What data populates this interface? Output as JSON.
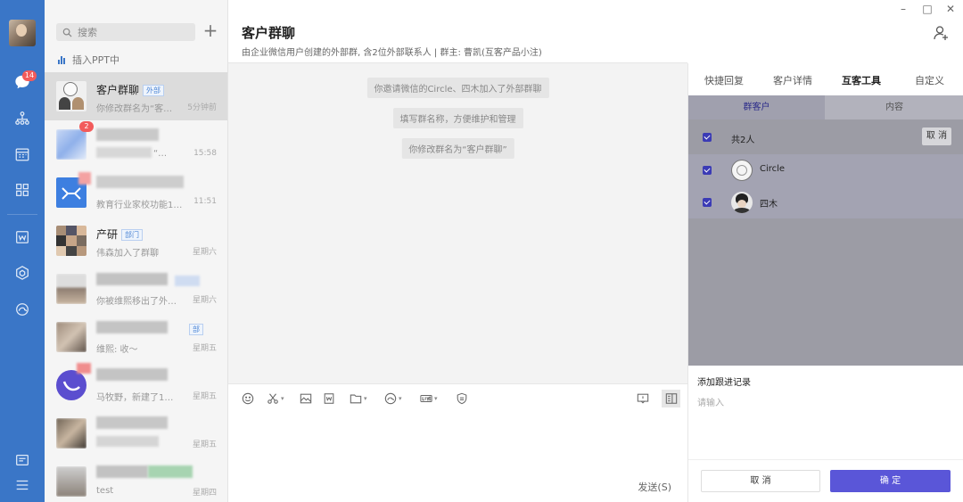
{
  "nav": {
    "badge_count": "14"
  },
  "sidebar": {
    "search_placeholder": "搜索",
    "add_symbol": "+",
    "ppt_status": "插入PPT中"
  },
  "conversations": [
    {
      "name": "客户群聊",
      "tag": "外部",
      "message": "你修改群名为“客…",
      "time": "5分钟前"
    },
    {
      "name": "",
      "tag": "",
      "message": "“…",
      "time": "15:58",
      "badge": "2"
    },
    {
      "name": "",
      "tag": "",
      "message": "教育行业家校功能1…",
      "time": "11:51"
    },
    {
      "name": "产研",
      "tag": "部门",
      "message": "伟森加入了群聊",
      "time": "星期六"
    },
    {
      "name": "",
      "tag": "",
      "message": "你被维熙移出了外…",
      "time": "星期六"
    },
    {
      "name": "",
      "tag": "部",
      "message": "维熙: 收～",
      "time": "星期五"
    },
    {
      "name": "",
      "tag": "",
      "message": "马牧野，新建了1…",
      "time": "星期五"
    },
    {
      "name": "",
      "tag": "",
      "message": "",
      "time": "星期五"
    },
    {
      "name": "",
      "tag": "",
      "message": "test",
      "time": "星期四"
    }
  ],
  "chat": {
    "title": "客户群聊",
    "subtitle": "由企业微信用户创建的外部群, 含2位外部联系人  |  群主: 曹凯(互客产品小注)",
    "system_messages": [
      "你邀请微信的Circle、四木加入了外部群聊",
      "填写群名称，方便维护和管理",
      "你修改群名为“客户群聊”"
    ],
    "send_label": "发送(S)"
  },
  "window": {
    "minimize": "–",
    "maximize": "□",
    "close": "✕"
  },
  "panel": {
    "tabs": [
      "快捷回复",
      "客户详情",
      "互客工具",
      "自定义"
    ],
    "active_tab": "互客工具",
    "subtabs": [
      "群客户",
      "内容"
    ],
    "total_label": "共2人",
    "cancel_small": "取 消",
    "members": [
      {
        "name": "Circle"
      },
      {
        "name": "四木"
      }
    ],
    "follow_title": "添加跟进记录",
    "follow_placeholder": "请输入",
    "cancel_button": "取 消",
    "confirm_button": "确 定"
  },
  "colors": {
    "nav_blue": "#3a76c7",
    "accent_purple": "#5a56d8",
    "badge_red": "#f25b5b"
  }
}
